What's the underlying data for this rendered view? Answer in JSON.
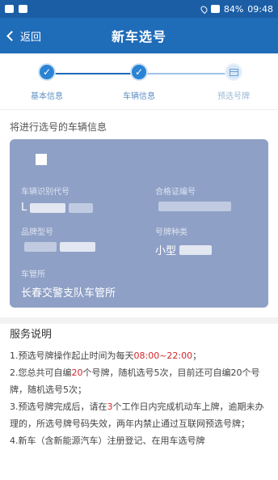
{
  "statusbar": {
    "battery": "84%",
    "time": "09:48"
  },
  "navbar": {
    "back_label": "返回",
    "title": "新车选号"
  },
  "steps": [
    {
      "label": "基本信息",
      "state": "done"
    },
    {
      "label": "车辆信息",
      "state": "done"
    },
    {
      "label": "预选号牌",
      "state": "todo"
    }
  ],
  "vehicle_section_label": "将进行选号的车辆信息",
  "vehicle": {
    "vin_label": "车辆识别代号",
    "vin_value": "L",
    "cert_label": "合格证编号",
    "cert_value": "",
    "model_label": "品牌型号",
    "model_value": "",
    "plate_type_label": "号牌种类",
    "plate_type_value": "小型",
    "office_label": "车管所",
    "office_value": "长春交警支队车管所"
  },
  "notes": {
    "title": "服务说明",
    "items": [
      {
        "prefix": "1.预选号牌操作起止时间为每天",
        "highlight": "08:00~22:00",
        "suffix": "；"
      },
      {
        "prefix": "2.您总共可自编",
        "highlight": "20",
        "suffix": "个号牌，随机选号5次，目前还可自编20个号牌，随机选号5次；"
      },
      {
        "prefix": "3.预选号牌完成后，请在",
        "highlight": "3",
        "suffix": "个工作日内完成机动车上牌，逾期未办理的，所选号牌号码失效，两年内禁止通过互联网预选号牌；"
      },
      {
        "prefix": "4.新车（含新能源汽车）注册登记、在用车选号牌",
        "highlight": "",
        "suffix": ""
      }
    ]
  },
  "colors": {
    "primary": "#1f6cb8",
    "card": "#8fa0c6",
    "highlight": "#d2262b"
  }
}
